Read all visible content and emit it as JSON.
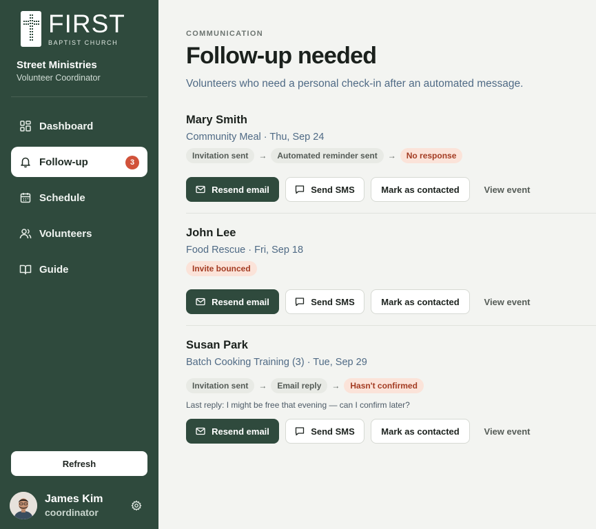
{
  "sidebar": {
    "logo": {
      "title": "FIRST",
      "subtitle": "BAPTIST CHURCH"
    },
    "org_name": "Street Ministries",
    "org_role": "Volunteer Coordinator",
    "nav": [
      {
        "label": "Dashboard",
        "icon": "grid-icon"
      },
      {
        "label": "Follow-up",
        "icon": "bell-icon",
        "badge": "3",
        "active": true
      },
      {
        "label": "Schedule",
        "icon": "calendar-icon"
      },
      {
        "label": "Volunteers",
        "icon": "users-icon"
      },
      {
        "label": "Guide",
        "icon": "book-icon"
      }
    ],
    "refresh_label": "Refresh",
    "user": {
      "name": "James Kim",
      "role": "coordinator"
    }
  },
  "main": {
    "kicker": "COMMUNICATION",
    "title": "Follow-up needed",
    "subtitle": "Volunteers who need a personal check-in after an automated message.",
    "actions": {
      "resend": "Resend email",
      "sms": "Send SMS",
      "contacted": "Mark as contacted",
      "view": "View event"
    },
    "items": [
      {
        "name": "Mary Smith",
        "event": "Community Meal · Thu, Sep 24",
        "steps": [
          "Invitation sent",
          "Automated reminder sent"
        ],
        "status": "No response"
      },
      {
        "name": "John Lee",
        "event": "Food Rescue · Fri, Sep 18",
        "steps": [],
        "status": "Invite bounced"
      },
      {
        "name": "Susan Park",
        "event": "Batch Cooking Training (3) · Tue, Sep 29",
        "steps": [
          "Invitation sent",
          "Email reply"
        ],
        "status": "Hasn't confirmed",
        "last_reply": "Last reply: I might be free that evening — can I confirm later?"
      }
    ]
  },
  "colors": {
    "sidebar_bg": "#2f4a3d",
    "primary": "#2f4a3d",
    "badge": "#d1523a",
    "alert_chip_bg": "#fbe3d9",
    "alert_chip_text": "#a33b22",
    "muted_blue": "#4f6a85"
  }
}
